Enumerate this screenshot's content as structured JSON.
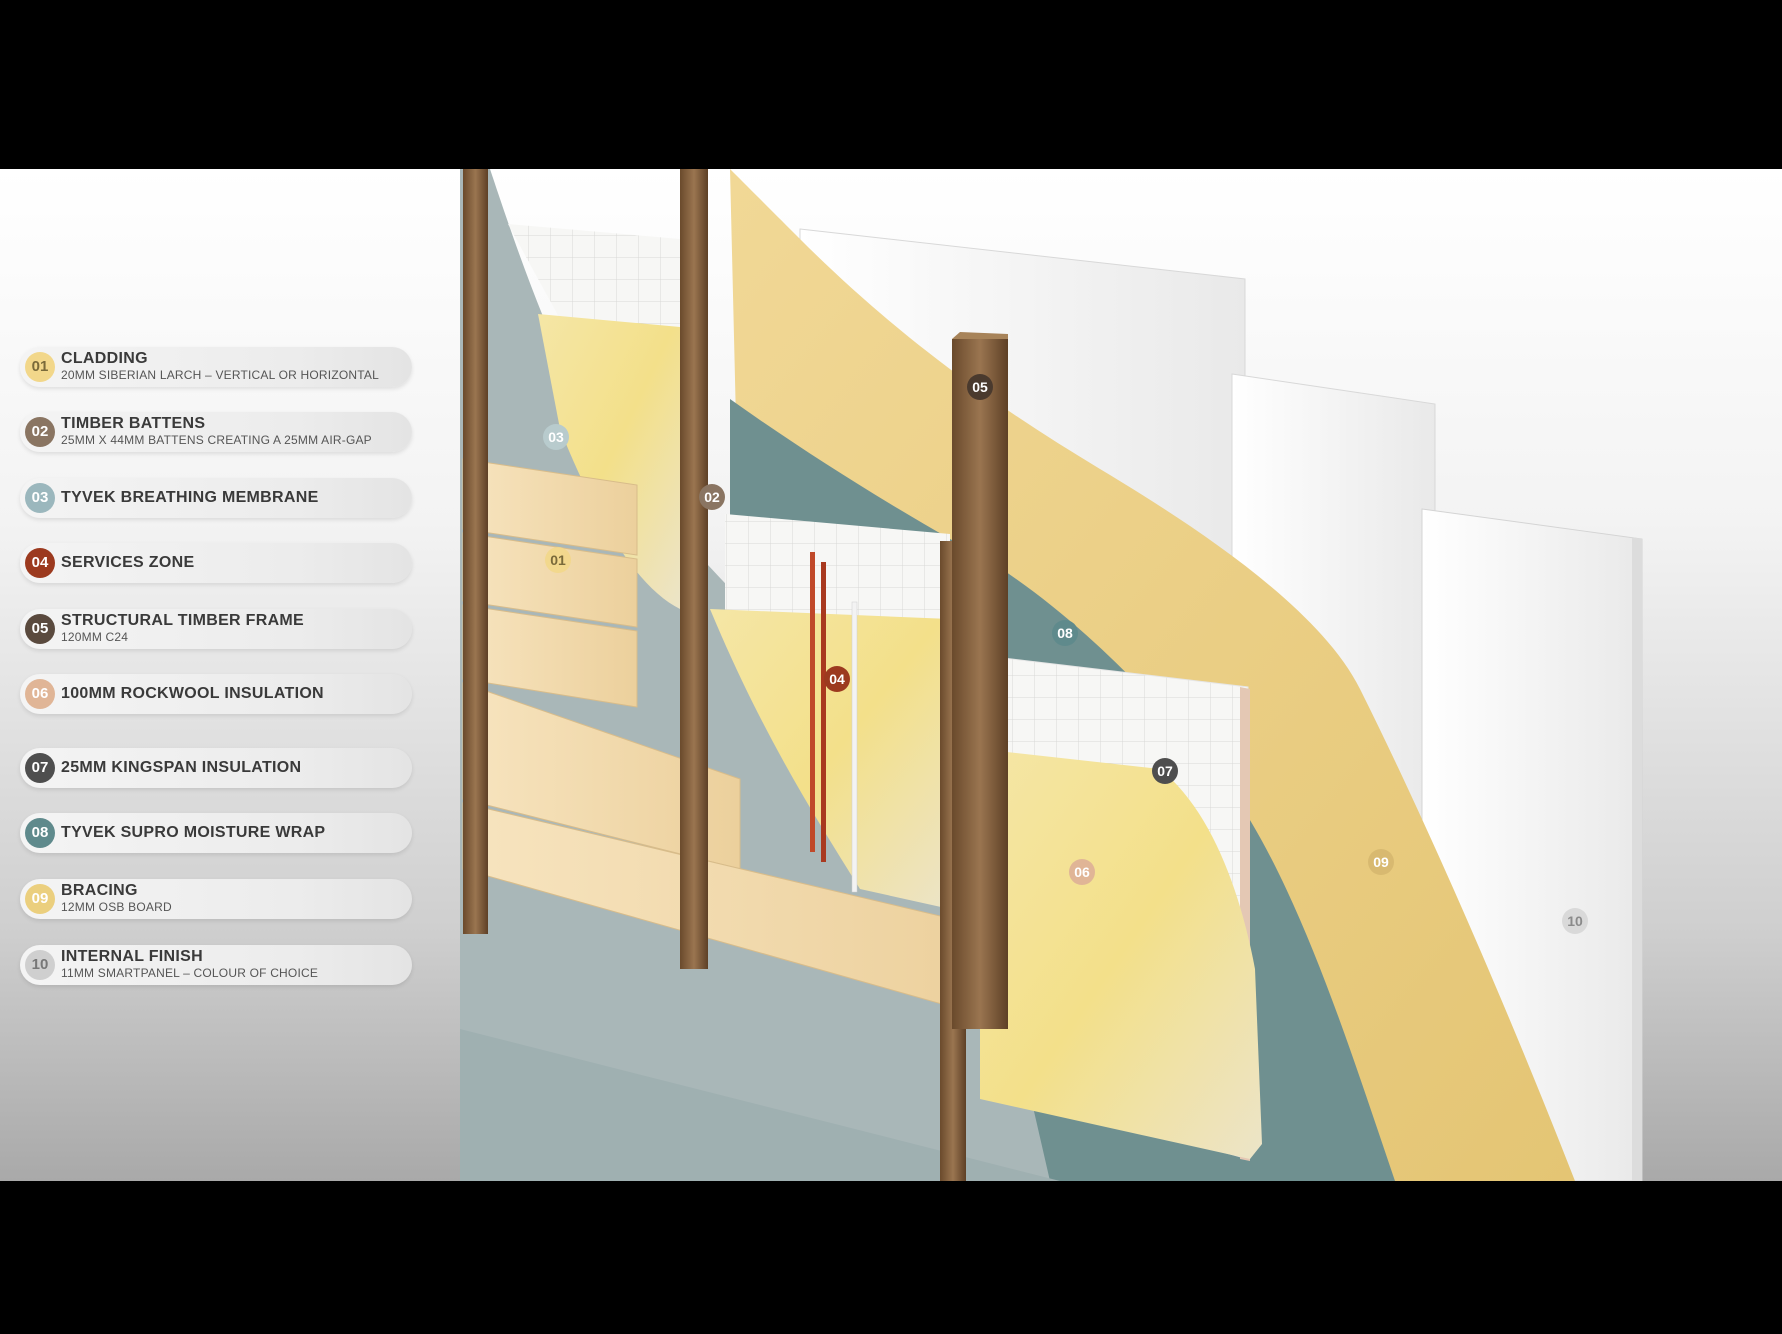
{
  "legend": [
    {
      "num": "01",
      "title": "CLADDING",
      "subtitle": "20MM SIBERIAN LARCH – VERTICAL OR HORIZONTAL",
      "color": "#f2d78a",
      "text_color": "#7a6a3a"
    },
    {
      "num": "02",
      "title": "TIMBER BATTENS",
      "subtitle": "25MM X 44MM BATTENS CREATING A 25MM AIR-GAP",
      "color": "#8a7562",
      "text_color": "#ffffff"
    },
    {
      "num": "03",
      "title": "TYVEK BREATHING MEMBRANE",
      "subtitle": "",
      "color": "#9bb7bd",
      "text_color": "#ffffff"
    },
    {
      "num": "04",
      "title": "SERVICES ZONE",
      "subtitle": "",
      "color": "#9c3a1f",
      "text_color": "#ffffff"
    },
    {
      "num": "05",
      "title": "STRUCTURAL TIMBER FRAME",
      "subtitle": "120MM C24",
      "color": "#5a4a3e",
      "text_color": "#ffffff"
    },
    {
      "num": "06",
      "title": "100MM ROCKWOOL INSULATION",
      "subtitle": "",
      "color": "#e0b596",
      "text_color": "#ffffff"
    },
    {
      "num": "07",
      "title": "25MM KINGSPAN INSULATION",
      "subtitle": "",
      "color": "#4e4e4e",
      "text_color": "#ffffff"
    },
    {
      "num": "08",
      "title": "TYVEK SUPRO MOISTURE WRAP",
      "subtitle": "",
      "color": "#5f8a8c",
      "text_color": "#ffffff"
    },
    {
      "num": "09",
      "title": "BRACING",
      "subtitle": "12MM OSB BOARD",
      "color": "#ebcf7e",
      "text_color": "#ffffff"
    },
    {
      "num": "10",
      "title": "INTERNAL FINISH",
      "subtitle": "11MM SMARTPANEL – COLOUR OF CHOICE",
      "color": "#cfcfcf",
      "text_color": "#777777"
    }
  ],
  "tags": {
    "t01": "01",
    "t02": "02",
    "t03": "03",
    "t04": "04",
    "t05": "05",
    "t06": "06",
    "t07": "07",
    "t08": "08",
    "t09": "09",
    "t10": "10"
  },
  "colors": {
    "cladding": "#f2d9a8",
    "batten": "#8b6a45",
    "membrane": "#a9b8b9",
    "services_pipe": "#c0492a",
    "frame": "#7a5a3c",
    "rockwool": "#f1dc93",
    "kingspan": "#f4f4f2",
    "moisture_wrap": "#6e8f8f",
    "osb": "#e9cf84",
    "internal": "#f2f2f2"
  }
}
